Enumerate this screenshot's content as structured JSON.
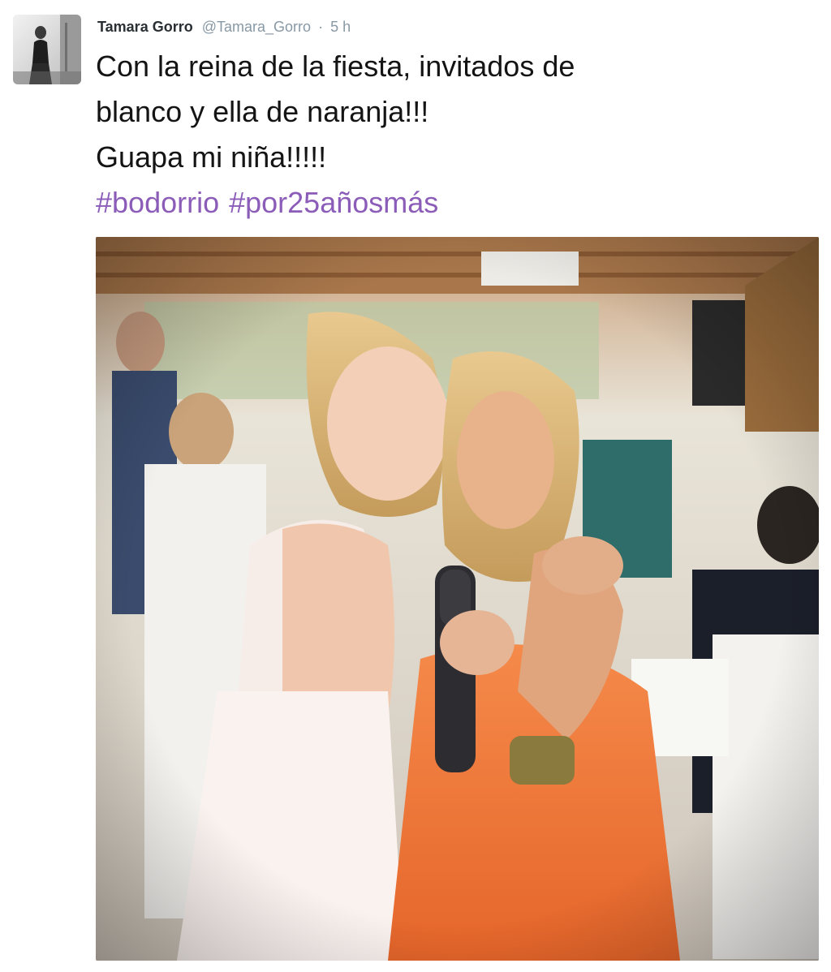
{
  "tweet": {
    "author": {
      "fullname": "Tamara Gorro",
      "username": "@Tamara_Gorro"
    },
    "separator": "·",
    "timestamp": "5 h",
    "text_lines": [
      "Con la reina de la fiesta, invitados de",
      "blanco y ella de naranja!!!",
      "Guapa mi niña!!!!!"
    ],
    "hashtags": [
      "#bodorrio",
      "#por25añosmás"
    ]
  },
  "colors": {
    "hashtag": "#8b5db8",
    "meta_text": "#8899a6",
    "body_text": "#141414",
    "dress_orange": "#f47a3a"
  },
  "icons": {
    "avatar": "profile-photo",
    "media": "party-photo"
  }
}
